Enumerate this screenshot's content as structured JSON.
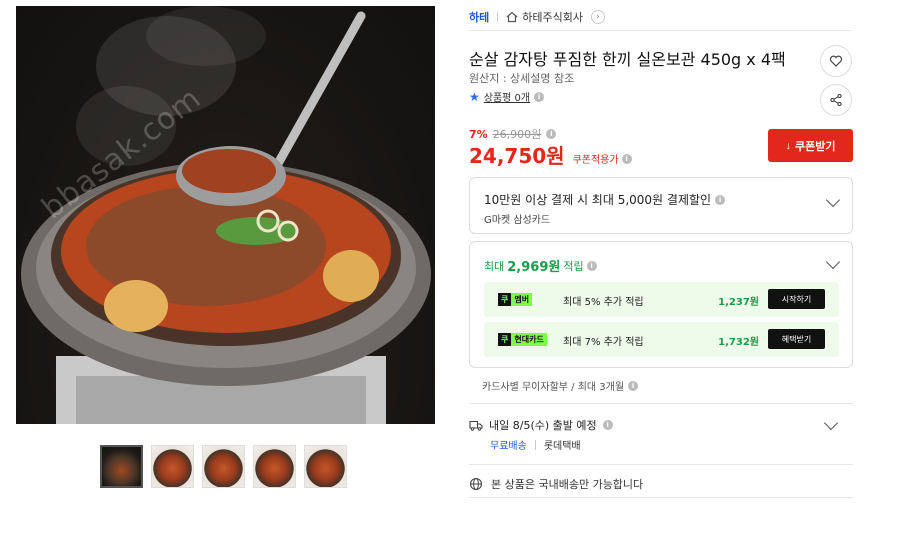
{
  "image": {
    "watermark": "bbasak.com",
    "thumbnail_count": 5
  },
  "brand": {
    "name": "하테",
    "store_name": "하테주식회사"
  },
  "product": {
    "title": "순살 감자탕 푸짐한 한끼 실온보관 450g x 4팩",
    "origin": "원산지 : 상세설명 참조",
    "review_label": "상품평 0개"
  },
  "pricing": {
    "discount_rate": "7%",
    "original_price": "26,900원",
    "sale_price": "24,750원",
    "coupon_note": "쿠폰적용가",
    "coupon_button": "쿠폰받기"
  },
  "card_benefit": {
    "text": "10만원 이상 결제 시 최대 5,000원 결제할인",
    "card": "G마켓 삼성카드"
  },
  "points": {
    "prefix": "최대",
    "amount": "2,969원",
    "suffix": "적립",
    "rewards": [
      {
        "badge_icon": "쿠",
        "badge": "멤버",
        "desc": "최대 5% 추가 적립",
        "amount": "1,237원",
        "button": "시작하기"
      },
      {
        "badge_icon": "쿠",
        "badge": "현대카드",
        "desc": "최대 7% 추가 적립",
        "amount": "1,732원",
        "button": "혜택받기"
      }
    ]
  },
  "installment": "카드사별 무이자할부 / 최대 3개월",
  "shipping": {
    "eta": "내일 8/5(수) 출발 예정",
    "fee": "무료배송",
    "carrier": "롯데택배"
  },
  "domestic_notice": "본 상품은 국내배송만 가능합니다",
  "colors": {
    "accent_red": "#e3271b",
    "link_blue": "#1e5bd6",
    "point_green": "#1a9d4b",
    "badge_lime": "#7dff4a"
  }
}
